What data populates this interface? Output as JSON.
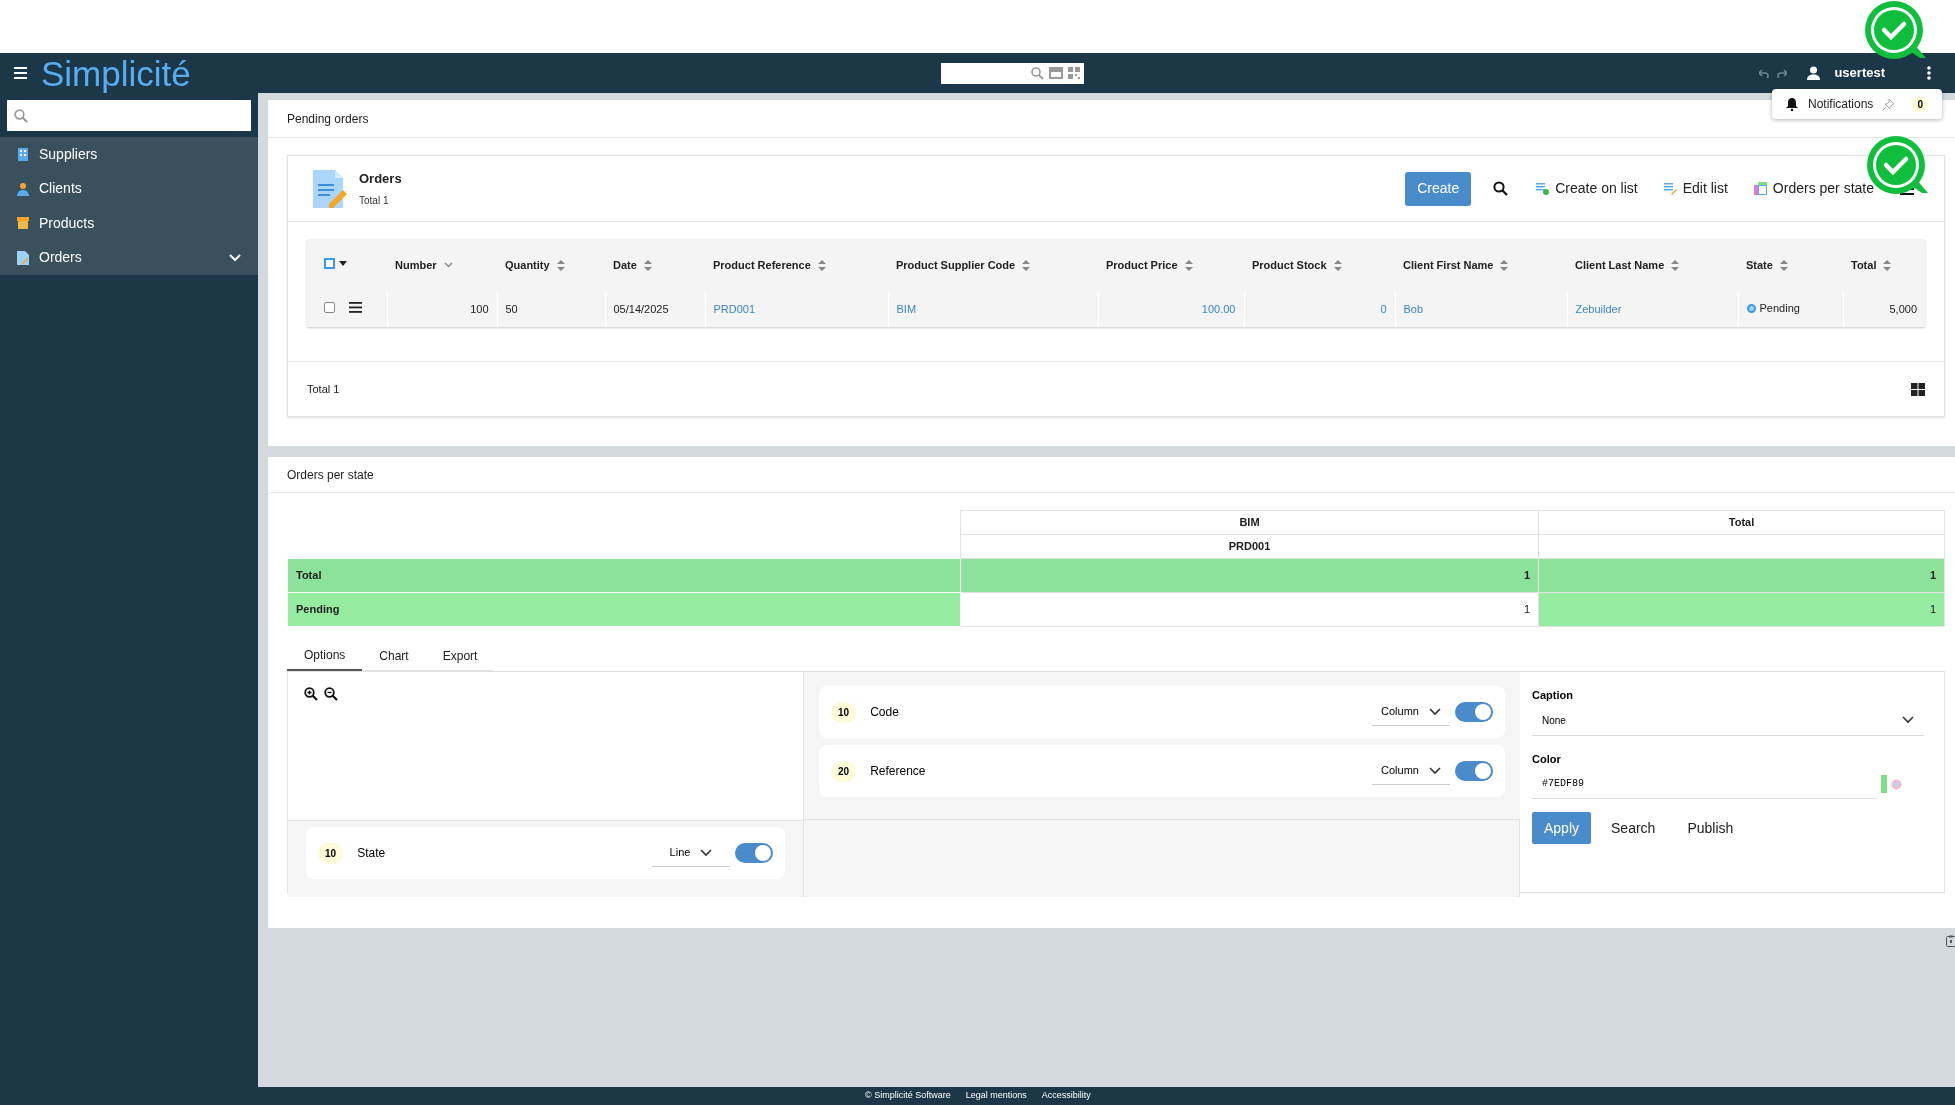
{
  "header": {
    "logo": "Simplicité",
    "user": "usertest"
  },
  "notifications": {
    "label": "Notifications",
    "count": "0"
  },
  "sidebar": {
    "items": [
      {
        "label": "Suppliers",
        "kind": "item"
      },
      {
        "label": "Clients",
        "kind": "item"
      },
      {
        "label": "Products",
        "kind": "item"
      },
      {
        "label": "Orders",
        "kind": "group"
      }
    ]
  },
  "pending_orders": {
    "title": "Pending orders",
    "list": {
      "title": "Orders",
      "subtitle": "Total 1",
      "actions": [
        {
          "label": "Create",
          "kind": "primary"
        },
        {
          "label": "Create on list",
          "kind": "link"
        },
        {
          "label": "Edit list",
          "kind": "link"
        },
        {
          "label": "Orders per state",
          "kind": "link"
        }
      ],
      "select_all": {
        "checked": false
      },
      "columns": [
        {
          "label": "Number",
          "sorted": true
        },
        {
          "label": "Quantity",
          "sorted": false
        },
        {
          "label": "Date",
          "sorted": false
        },
        {
          "label": "Product Reference",
          "sorted": false
        },
        {
          "label": "Product Supplier Code",
          "sorted": false
        },
        {
          "label": "Product Price",
          "sorted": false
        },
        {
          "label": "Product Stock",
          "sorted": false
        },
        {
          "label": "Client First Name",
          "sorted": false
        },
        {
          "label": "Client Last Name",
          "sorted": false
        },
        {
          "label": "State",
          "sorted": false
        },
        {
          "label": "Total",
          "sorted": false
        }
      ],
      "rows": [
        {
          "selected": false,
          "cells": [
            {
              "text": "100",
              "kind": "num"
            },
            {
              "text": "50",
              "kind": "text"
            },
            {
              "text": "05/14/2025",
              "kind": "text"
            },
            {
              "text": "PRD001",
              "kind": "link"
            },
            {
              "text": "BIM",
              "kind": "link"
            },
            {
              "text": "100.00",
              "kind": "link-num"
            },
            {
              "text": "0",
              "kind": "link-num"
            },
            {
              "text": "Bob",
              "kind": "link"
            },
            {
              "text": "Zebuilder",
              "kind": "link"
            },
            {
              "text": "Pending",
              "kind": "state"
            },
            {
              "text": "5,000",
              "kind": "num"
            }
          ]
        }
      ],
      "footer": "Total 1"
    }
  },
  "orders_per_state": {
    "title": "Orders per state",
    "pivot": {
      "header_rows": [
        [
          "BIM",
          "Total"
        ],
        [
          "PRD001"
        ]
      ],
      "rows": [
        {
          "label": "Total",
          "kind": "total",
          "values": [
            "1",
            "1"
          ]
        },
        {
          "label": "Pending",
          "kind": "line",
          "values": [
            "1",
            "1"
          ]
        }
      ]
    },
    "tabs": [
      {
        "label": "Options",
        "selected": true
      },
      {
        "label": "Chart",
        "selected": false
      },
      {
        "label": "Export",
        "selected": false
      }
    ],
    "column_axes": [
      {
        "order": "10",
        "label": "Code",
        "mode": "Column",
        "on": true
      },
      {
        "order": "20",
        "label": "Reference",
        "mode": "Column",
        "on": true
      }
    ],
    "line_axes": [
      {
        "order": "10",
        "label": "State",
        "mode": "Line",
        "on": true
      }
    ],
    "caption": {
      "label": "Caption",
      "value": "None"
    },
    "color": {
      "label": "Color",
      "value": "#7EDF89"
    },
    "buttons": [
      {
        "label": "Apply",
        "kind": "primary"
      },
      {
        "label": "Search",
        "kind": "plain"
      },
      {
        "label": "Publish",
        "kind": "plain"
      }
    ]
  },
  "footer": {
    "links": [
      "© Simplicité Software",
      "Legal mentions",
      "Accessibility"
    ]
  }
}
